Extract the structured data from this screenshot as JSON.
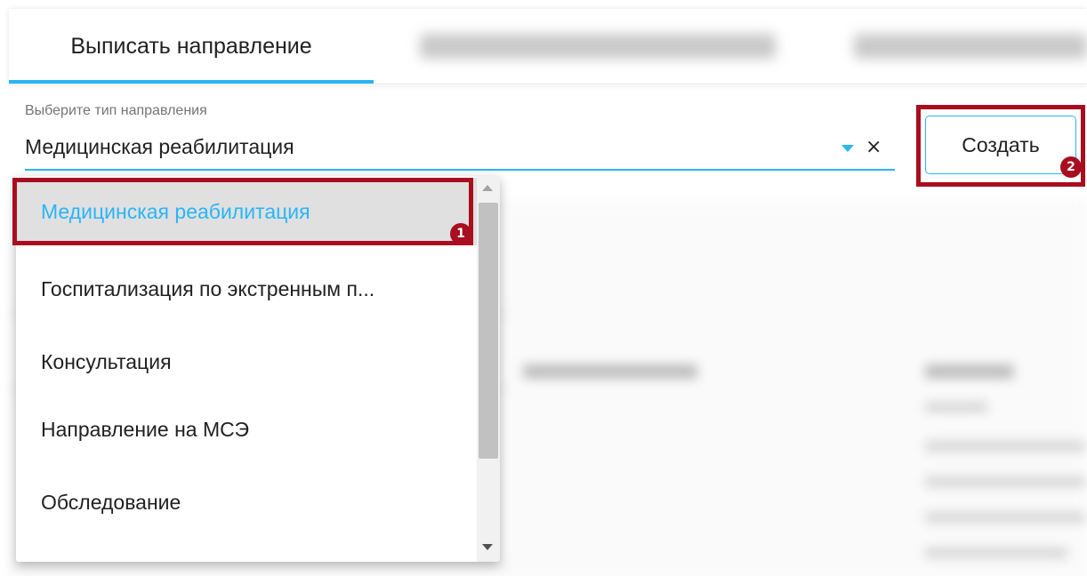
{
  "tabs": {
    "active_label": "Выписать направление",
    "indicator_color": "#29b6f6"
  },
  "referral_form": {
    "type_label": "Выберите тип направления",
    "type_value": "Медицинская реабилитация",
    "clear_icon": "close-icon",
    "clear_glyph": "×",
    "arrow_icon": "caret-down-icon",
    "create_label": "Создать"
  },
  "dropdown": {
    "options": [
      "Медицинская реабилитация",
      "Госпитализация по экстренным п...",
      "Консультация",
      "Направление на МСЭ",
      "Обследование"
    ],
    "selected_index": 0
  },
  "annotations": {
    "badge_1": "1",
    "badge_2": "2",
    "highlight_color": "#a80e1f"
  },
  "colors": {
    "accent": "#29b6f6",
    "text": "#212121",
    "muted": "#757575"
  }
}
